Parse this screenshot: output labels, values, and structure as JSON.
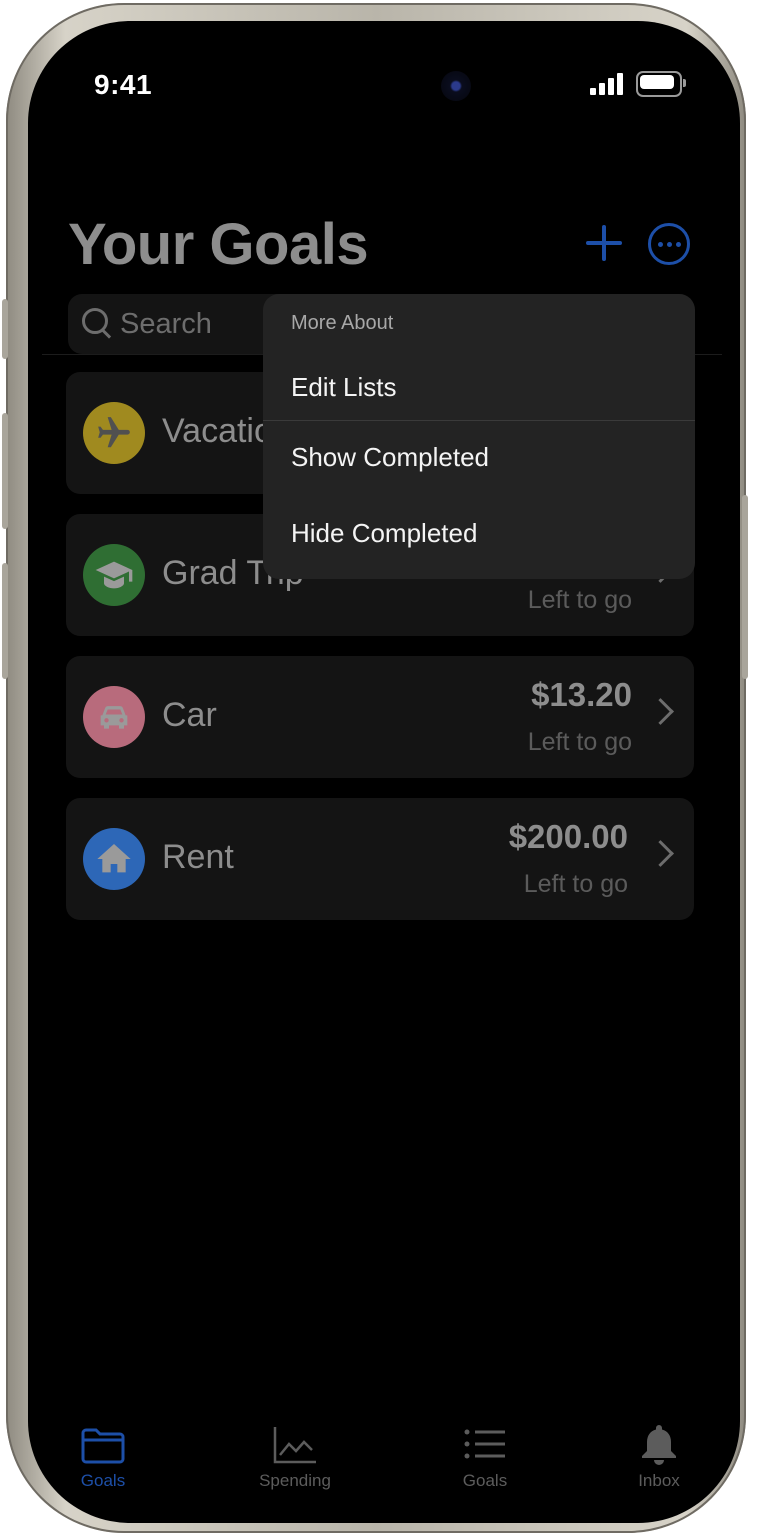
{
  "status": {
    "time": "9:41"
  },
  "header": {
    "title": "Your Goals"
  },
  "search": {
    "placeholder": "Search"
  },
  "goals": [
    {
      "name": "Vacation",
      "amount": "",
      "sub": "",
      "icon": "airplane-icon",
      "color": "#a08a1f"
    },
    {
      "name": "Grad Trip",
      "amount": "",
      "sub": "Left to go",
      "icon": "graduation-cap-icon",
      "color": "#2f6e33"
    },
    {
      "name": "Car",
      "amount": "$13.20",
      "sub": "Left to go",
      "icon": "car-icon",
      "color": "#b86b7c"
    },
    {
      "name": "Rent",
      "amount": "$200.00",
      "sub": "Left to go",
      "icon": "house-icon",
      "color": "#2d67b7"
    }
  ],
  "menu": {
    "header": "More About",
    "items": [
      "Edit Lists",
      "Show Completed",
      "Hide Completed"
    ]
  },
  "tabs": [
    {
      "label": "Goals",
      "icon": "folder-icon",
      "active": true
    },
    {
      "label": "Spending",
      "icon": "chart-icon",
      "active": false
    },
    {
      "label": "Goals",
      "icon": "list-icon",
      "active": false
    },
    {
      "label": "Inbox",
      "icon": "bell-icon",
      "active": false
    }
  ],
  "colors": {
    "accent": "#1d4fa8",
    "background": "#000000",
    "card": "#141414",
    "menu": "#232323"
  }
}
